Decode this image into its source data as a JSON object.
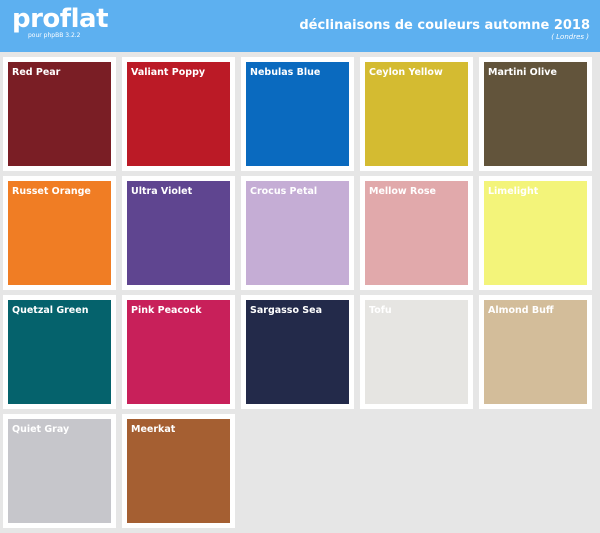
{
  "header": {
    "logo": "proflat",
    "logo_sub": "pour phpBB 3.2.2",
    "title": "déclinaisons de couleurs automne 2018",
    "subtitle": "( Londres )",
    "background": "#5db0f0"
  },
  "swatches": [
    {
      "name": "Red Pear",
      "color": "#7a1e25"
    },
    {
      "name": "Valiant Poppy",
      "color": "#bb1a26"
    },
    {
      "name": "Nebulas Blue",
      "color": "#0a6abf"
    },
    {
      "name": "Ceylon Yellow",
      "color": "#d4bb31"
    },
    {
      "name": "Martini Olive",
      "color": "#62543b"
    },
    {
      "name": "Russet Orange",
      "color": "#f07d24"
    },
    {
      "name": "Ultra Violet",
      "color": "#5f4590"
    },
    {
      "name": "Crocus Petal",
      "color": "#c5add5"
    },
    {
      "name": "Mellow Rose",
      "color": "#e1a9ab"
    },
    {
      "name": "Limelight",
      "color": "#f3f47a"
    },
    {
      "name": "Quetzal Green",
      "color": "#05626c"
    },
    {
      "name": "Pink Peacock",
      "color": "#c8205a"
    },
    {
      "name": "Sargasso Sea",
      "color": "#232a4a"
    },
    {
      "name": "Tofu",
      "color": "#e6e5e2"
    },
    {
      "name": "Almond Buff",
      "color": "#d3bd9a"
    },
    {
      "name": "Quiet Gray",
      "color": "#c6c6cb"
    },
    {
      "name": "Meerkat",
      "color": "#a55f32"
    }
  ]
}
